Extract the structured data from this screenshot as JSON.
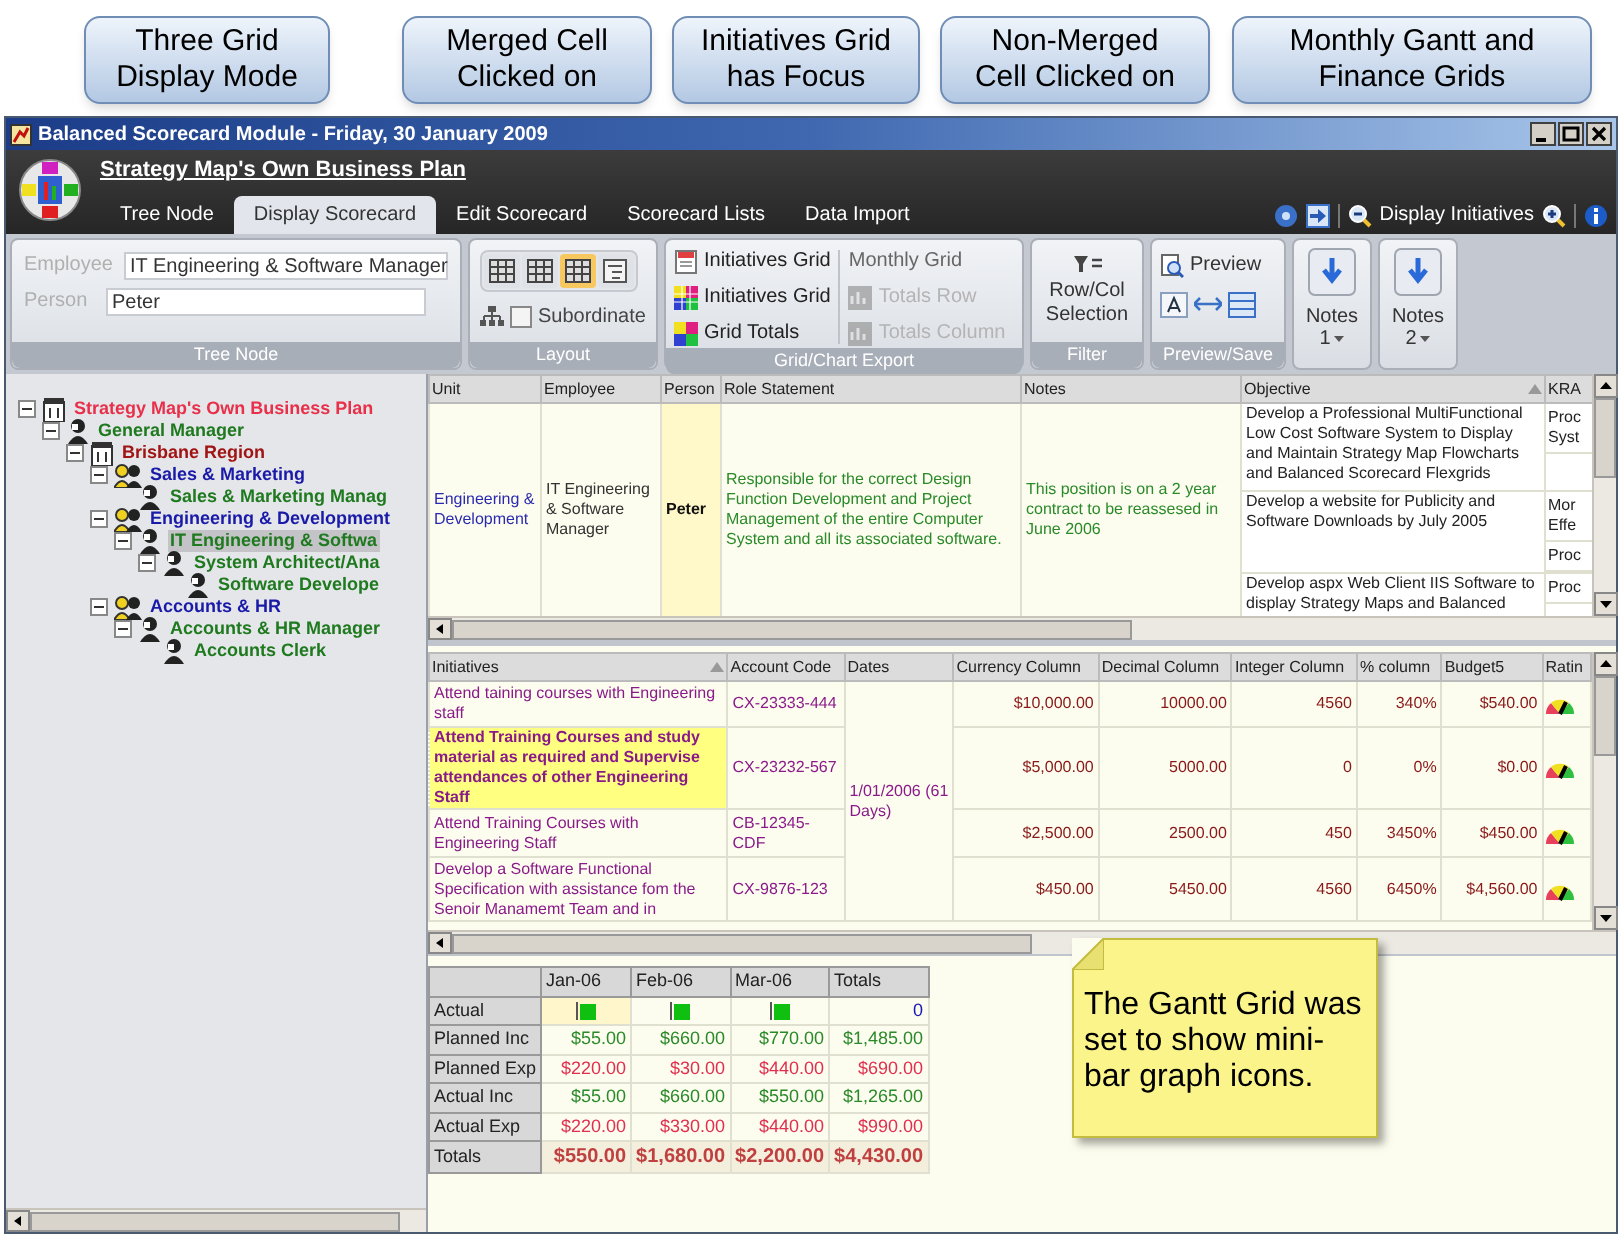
{
  "callouts": [
    {
      "lines": [
        "Three Grid",
        "Display Mode"
      ]
    },
    {
      "lines": [
        "Merged Cell",
        "Clicked on"
      ]
    },
    {
      "lines": [
        "Initiatives Grid",
        "has Focus"
      ]
    },
    {
      "lines": [
        "Non-Merged",
        "Cell Clicked on"
      ]
    },
    {
      "lines": [
        "Monthly Gantt and",
        "Finance Grids"
      ]
    }
  ],
  "window": {
    "title": "Balanced Scorecard Module - Friday, 30 January 2009"
  },
  "header": {
    "plan": "Strategy Map's Own Business Plan"
  },
  "tabs": [
    {
      "label": "Tree Node",
      "selected": false
    },
    {
      "label": "Display Scorecard",
      "selected": true
    },
    {
      "label": "Edit Scorecard",
      "selected": false
    },
    {
      "label": "Scorecard Lists",
      "selected": false
    },
    {
      "label": "Data Import",
      "selected": false
    }
  ],
  "display_toggle": {
    "label": "Display Initiatives"
  },
  "ribbon": {
    "tree_node": {
      "employee_label": "Employee",
      "employee": "IT Engineering & Software Manager",
      "person_label": "Person",
      "person": "Peter",
      "caption": "Tree Node"
    },
    "layout": {
      "modes": [
        {
          "selected": false
        },
        {
          "selected": false
        },
        {
          "selected": true
        },
        {
          "selected": false
        }
      ],
      "subordinate": {
        "label": "Subordinate",
        "checked": false
      },
      "caption": "Layout"
    },
    "export": {
      "columns": [
        [
          {
            "label": "Initiatives Grid",
            "disabled": false
          },
          {
            "label": "Initiatives Grid",
            "disabled": false
          },
          {
            "label": "Grid Totals",
            "disabled": false
          }
        ],
        [
          {
            "label": "Monthly Grid",
            "disabled": false
          },
          {
            "label": "Totals Row",
            "disabled": true
          },
          {
            "label": "Totals Column",
            "disabled": true
          }
        ]
      ],
      "caption": "Grid/Chart Export"
    },
    "filter": {
      "label": "Row/Col Selection",
      "caption": "Filter"
    },
    "preview": {
      "label": "Preview",
      "caption": "Preview/Save"
    },
    "notes": [
      {
        "label": "Notes",
        "number": "1"
      },
      {
        "label": "Notes",
        "number": "2"
      }
    ]
  },
  "tree": [
    {
      "label": "Strategy Map's Own Business Plan",
      "kind": "building",
      "color": "#e8304a",
      "selected": false,
      "expanded": true,
      "children": [
        {
          "label": "General Manager",
          "kind": "person",
          "color": "#1f7a1f",
          "selected": false,
          "expanded": true,
          "children": [
            {
              "label": "Brisbane Region",
              "kind": "building",
              "color": "#a01414",
              "selected": false,
              "expanded": true,
              "children": [
                {
                  "label": "Sales & Marketing",
                  "kind": "group",
                  "color": "#1a1aa8",
                  "selected": false,
                  "expanded": true,
                  "children": [
                    {
                      "label": "Sales & Marketing Manag",
                      "kind": "person",
                      "color": "#1f7a1f",
                      "selected": false
                    }
                  ]
                },
                {
                  "label": "Engineering & Development",
                  "kind": "group",
                  "color": "#1a1aa8",
                  "selected": false,
                  "expanded": true,
                  "children": [
                    {
                      "label": "IT Engineering & Softwa",
                      "kind": "person",
                      "color": "#1f7a1f",
                      "selected": true,
                      "expanded": true,
                      "children": [
                        {
                          "label": "System Architect/Ana",
                          "kind": "person",
                          "color": "#1f7a1f",
                          "selected": false,
                          "expanded": true,
                          "children": [
                            {
                              "label": "Software Develope",
                              "kind": "person",
                              "color": "#1f7a1f",
                              "selected": false
                            }
                          ]
                        }
                      ]
                    }
                  ]
                },
                {
                  "label": "Accounts & HR",
                  "kind": "group",
                  "color": "#1a1aa8",
                  "selected": false,
                  "expanded": true,
                  "children": [
                    {
                      "label": "Accounts & HR Manager",
                      "kind": "person",
                      "color": "#1f7a1f",
                      "selected": false,
                      "expanded": true,
                      "children": [
                        {
                          "label": "Accounts Clerk",
                          "kind": "person",
                          "color": "#1f7a1f",
                          "selected": false
                        }
                      ]
                    }
                  ]
                }
              ]
            }
          ]
        }
      ]
    }
  ],
  "scorecard_grid": {
    "columns": [
      "Unit",
      "Employee",
      "Person",
      "Role Statement",
      "Notes",
      "Objective",
      "KRA"
    ],
    "unit": "Engineering & Development",
    "employee": "IT Engineering & Software Manager",
    "person": "Peter",
    "role": "Responsible for the correct Design Function Development and Project Management of the entire Computer System and all its associated software.",
    "notes": "This position is on a 2 year contract to be reassesed in June 2006",
    "objectives": [
      {
        "text": "Develop a Professional MultiFunctional Low Cost Software System to Display and Maintain Strategy Map Flowcharts and Balanced Scorecard Flexgrids",
        "kra": [
          "Proc Syst"
        ]
      },
      {
        "text": "Develop a website for Publicity and Software Downloads by July 2005",
        "kra": [
          "Mor Effe",
          "Proc"
        ]
      },
      {
        "text": "Develop aspx Web Client IIS Software to display Strategy Maps and Balanced",
        "kra": [
          "Proc"
        ]
      }
    ]
  },
  "initiatives_grid": {
    "columns": [
      "Initiatives",
      "Account Code",
      "Dates",
      "Currency Column",
      "Decimal Column",
      "Integer Column",
      "% column",
      "Budget5",
      "Ratin"
    ],
    "dates": "1/01/2006 (61 Days)",
    "rows": [
      {
        "initiative": "Attend taining courses with Engineering staff",
        "account": "CX-23333-444",
        "currency": "$10,000.00",
        "decimal": "10000.00",
        "integer": "4560",
        "percent": "340%",
        "budget": "$540.00",
        "selected": false
      },
      {
        "initiative": "Attend Training Courses and study material as required and Supervise attendances of other Engineering Staff",
        "account": "CX-23232-567",
        "currency": "$5,000.00",
        "decimal": "5000.00",
        "integer": "0",
        "percent": "0%",
        "budget": "$0.00",
        "selected": true
      },
      {
        "initiative": "Attend Training Courses with Engineering Staff",
        "account": "CB-12345-CDF",
        "currency": "$2,500.00",
        "decimal": "2500.00",
        "integer": "450",
        "percent": "3450%",
        "budget": "$450.00",
        "selected": false
      },
      {
        "initiative": "Develop a Software Functional Specification with assistance fom the Senoir Manamemt Team and in",
        "account": "CX-9876-123",
        "currency": "$450.00",
        "decimal": "5450.00",
        "integer": "4560",
        "percent": "6450%",
        "budget": "$4,560.00",
        "selected": false
      }
    ]
  },
  "gantt_grid": {
    "columns": [
      "Jan-06",
      "Feb-06",
      "Mar-06",
      "Totals"
    ],
    "rows": [
      {
        "label": "Actual",
        "kind": "bars",
        "total": "0"
      },
      {
        "label": "Planned Inc",
        "kind": "income",
        "values": [
          "$55.00",
          "$660.00",
          "$770.00"
        ],
        "total": "$1,485.00"
      },
      {
        "label": "Planned Exp",
        "kind": "expense",
        "values": [
          "$220.00",
          "$30.00",
          "$440.00"
        ],
        "total": "$690.00"
      },
      {
        "label": "Actual Inc",
        "kind": "income",
        "values": [
          "$55.00",
          "$660.00",
          "$550.00"
        ],
        "total": "$1,265.00"
      },
      {
        "label": "Actual Exp",
        "kind": "expense",
        "values": [
          "$220.00",
          "$330.00",
          "$440.00"
        ],
        "total": "$990.00"
      },
      {
        "label": "Totals",
        "kind": "total",
        "values": [
          "$550.00",
          "$1,680.00",
          "$2,200.00"
        ],
        "total": "$4,430.00"
      }
    ]
  },
  "note": {
    "text": "The Gantt Grid was set to show mini-bar graph icons."
  }
}
